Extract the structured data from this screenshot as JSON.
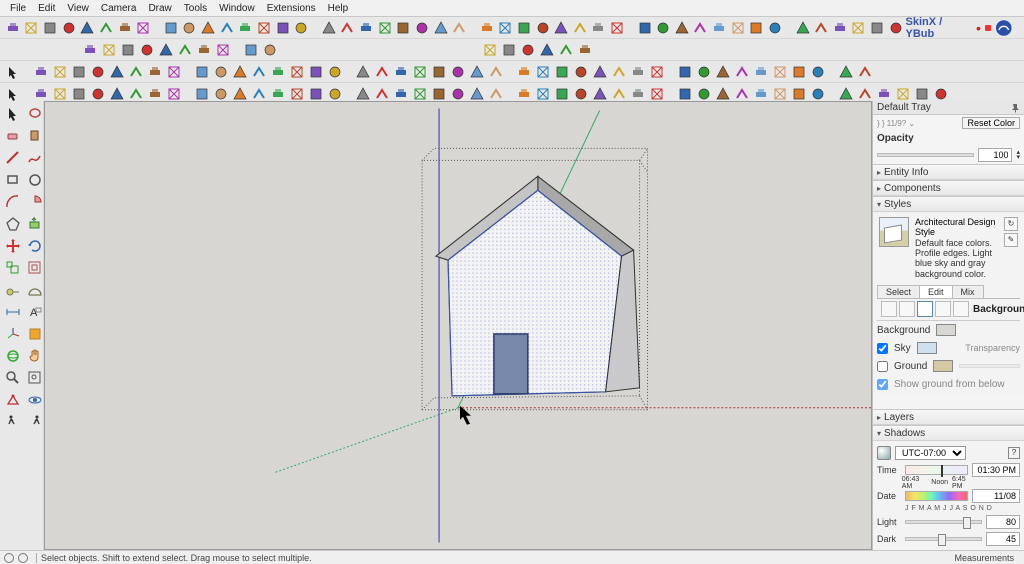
{
  "menu": {
    "items": [
      "File",
      "Edit",
      "View",
      "Camera",
      "Draw",
      "Tools",
      "Window",
      "Extensions",
      "Help"
    ]
  },
  "brand": {
    "label": "SkinX / YBub"
  },
  "tray": {
    "title": "Default Tray",
    "reset": "Reset Color",
    "opacity_label": "Opacity",
    "opacity_value": "100",
    "sections": {
      "entity": "Entity Info",
      "components": "Components",
      "styles": "Styles",
      "layers": "Layers",
      "shadows": "Shadows"
    },
    "style": {
      "name": "Architectural Design Style",
      "desc": "Default face colors. Profile edges. Light blue sky and gray background color.",
      "tabs": [
        "Select",
        "Edit",
        "Mix"
      ],
      "active_tab": 1
    },
    "background": {
      "heading": "Background",
      "bg_label": "Background",
      "bg_color": "#d8d6d2",
      "sky_label": "Sky",
      "sky_checked": true,
      "sky_color": "#cfe0ee",
      "ground_label": "Ground",
      "ground_checked": false,
      "ground_color": "#d3c9a2",
      "transparency": "Transparency",
      "showground": "Show ground from below",
      "showground_checked": true
    },
    "shadows": {
      "tz": "UTC-07:00",
      "time_label": "Time",
      "time_min": "06:43 AM",
      "time_noon": "Noon",
      "time_max": "6:45 PM",
      "time_value": "01:30 PM",
      "date_label": "Date",
      "months": "J F M A M J J A S O N D",
      "date_value": "11/08",
      "light_label": "Light",
      "light_value": "80",
      "dark_label": "Dark",
      "dark_value": "45"
    }
  },
  "statusbar": {
    "hint": "Select objects. Shift to extend select. Drag mouse to select multiple.",
    "measurements": "Measurements"
  },
  "chart_data": null
}
